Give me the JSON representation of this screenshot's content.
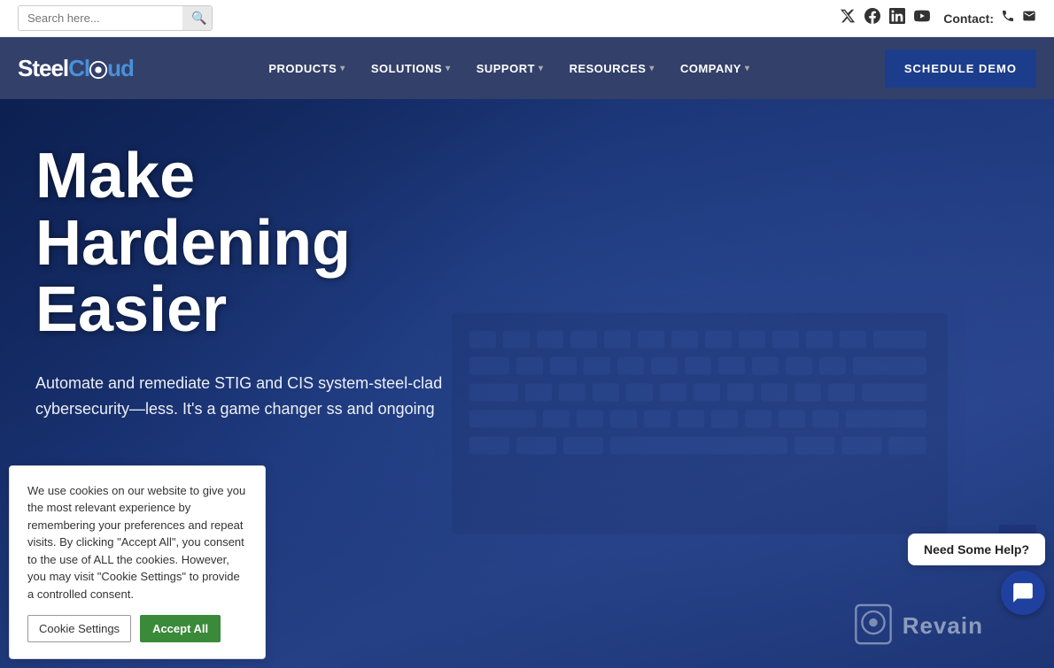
{
  "topbar": {
    "search_placeholder": "Search here...",
    "search_button_icon": "🔍",
    "social_links": [
      {
        "name": "twitter",
        "icon": "𝕏",
        "unicode": "🐦"
      },
      {
        "name": "facebook",
        "icon": "f"
      },
      {
        "name": "linkedin",
        "icon": "in"
      },
      {
        "name": "youtube",
        "icon": "▶"
      }
    ],
    "contact_label": "Contact:",
    "phone_icon": "📞",
    "email_icon": "✉"
  },
  "nav": {
    "logo_text": "SteelCloud",
    "items": [
      {
        "label": "PRODUCTS",
        "has_dropdown": true
      },
      {
        "label": "SOLUTIONS",
        "has_dropdown": true
      },
      {
        "label": "SUPPORT",
        "has_dropdown": true
      },
      {
        "label": "RESOURCES",
        "has_dropdown": true
      },
      {
        "label": "COMPANY",
        "has_dropdown": true
      }
    ],
    "cta_button": "SCHEDULE DEMO"
  },
  "hero": {
    "title": "Make Hardening Easier",
    "subtitle": "Automate and remediate STIG and CIS system-steel-clad cybersecurity—less. It's a game changer ss and ongoing"
  },
  "cookie_banner": {
    "text": "We use cookies on our website to give you the most relevant experience by remembering your preferences and repeat visits. By clicking \"Accept All\", you consent to the use of ALL the cookies. However, you may visit \"Cookie Settings\" to provide a controlled consent.",
    "settings_button": "Cookie Settings",
    "accept_button": "Accept All"
  },
  "help_widget": {
    "bubble_text": "Need Some Help?",
    "icon": "💬"
  },
  "revain": {
    "text": "Revain"
  },
  "scroll_top": {
    "icon": "^"
  }
}
